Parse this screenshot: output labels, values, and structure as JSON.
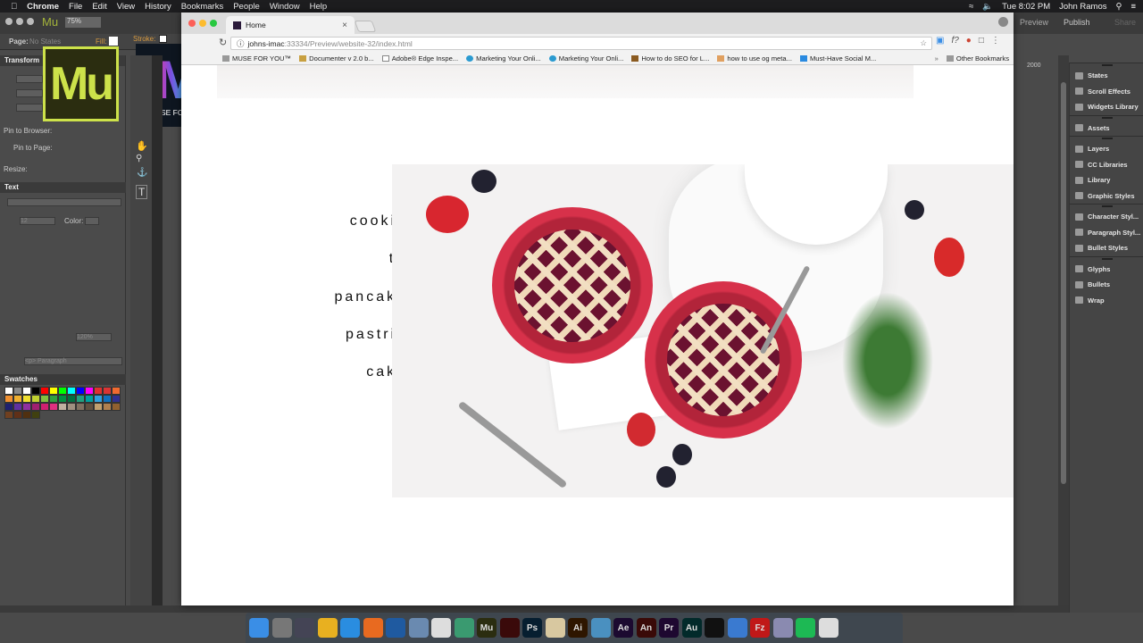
{
  "menubar": {
    "app": "Chrome",
    "items": [
      "File",
      "Edit",
      "View",
      "History",
      "Bookmarks",
      "People",
      "Window",
      "Help"
    ],
    "clock": "Tue 8:02 PM",
    "user": "John Ramos"
  },
  "muse": {
    "zoom": "75%",
    "page_label": "Page:",
    "page_value": "No States",
    "fill": "Fill:",
    "stroke": "Stroke:",
    "preview": "Preview",
    "publish": "Publish",
    "share": "Share",
    "ruler_mark": "2000",
    "transform": "Transform",
    "pin_browser": "Pin to Browser:",
    "pin_page": "Pin to Page:",
    "resize": "Resize:",
    "text": "Text",
    "color": "Color:",
    "font_size": "12",
    "leading": "120%",
    "paragraph": "<p> Paragraph",
    "swatches": "Swatches",
    "swatch_colors": [
      "#ffffff",
      "#888888",
      "#ffffff",
      "#000000",
      "#ff0000",
      "#ffff00",
      "#00ff00",
      "#00ffff",
      "#0000ff",
      "#ff00ff",
      "#e03030",
      "#d93535",
      "#f06a30",
      "#f09030",
      "#f0b030",
      "#f0e030",
      "#c0d030",
      "#80c040",
      "#30a040",
      "#009040",
      "#007040",
      "#20a080",
      "#00a0a0",
      "#30a0e0",
      "#1070c0",
      "#303090",
      "#202070",
      "#6030a0",
      "#9030a0",
      "#a02070",
      "#d02070",
      "#e03080",
      "#c0b0a0",
      "#a09080",
      "#807060",
      "#605040",
      "#c0a070",
      "#b08050",
      "#906030",
      "#704020",
      "#603018",
      "#503010",
      "#404010"
    ]
  },
  "rightpanel": {
    "groups": [
      [
        "States",
        "Scroll Effects",
        "Widgets Library"
      ],
      [
        "Assets"
      ],
      [
        "Layers",
        "CC Libraries",
        "Library",
        "Graphic Styles"
      ],
      [
        "Character Styl...",
        "Paragraph Styl...",
        "Bullet Styles"
      ],
      [
        "Glyphs",
        "Bullets",
        "Wrap"
      ]
    ]
  },
  "logos": {
    "mu": "Mu",
    "mfy_letter": "M",
    "mfy_text": "MUSE FOR YOU"
  },
  "browser": {
    "tab_title": "Home",
    "url_host": "johns-imac",
    "url_rest": ":33334/Preview/website-32/index.html",
    "bookmarks": [
      "MUSE FOR YOU™",
      "Documenter v 2.0 b...",
      "Adobe® Edge Inspe...",
      "Marketing Your Onli...",
      "Marketing Your Onli...",
      "How to do SEO for L...",
      "how to use og meta...",
      "Must-Have Social M..."
    ],
    "other_bookmarks": "Other Bookmarks"
  },
  "page": {
    "menu": [
      "cookies",
      "tea",
      "pancakes",
      "pastries",
      "cakes"
    ]
  },
  "dock": [
    {
      "label": "",
      "c": "#3a8ee6"
    },
    {
      "label": "",
      "c": "#777"
    },
    {
      "label": "",
      "c": "#445"
    },
    {
      "label": "",
      "c": "#e8b020"
    },
    {
      "label": "",
      "c": "#2a8de0"
    },
    {
      "label": "",
      "c": "#e86a20"
    },
    {
      "label": "",
      "c": "#1f5aa0"
    },
    {
      "label": "",
      "c": "#6a8ab0"
    },
    {
      "label": "",
      "c": "#ddd"
    },
    {
      "label": "",
      "c": "#3a9a70"
    },
    {
      "label": "Mu",
      "c": "#2b2d10"
    },
    {
      "label": "",
      "c": "#3a0a0a"
    },
    {
      "label": "Ps",
      "c": "#061e30"
    },
    {
      "label": "",
      "c": "#d8c8a0"
    },
    {
      "label": "Ai",
      "c": "#2e1600"
    },
    {
      "label": "",
      "c": "#4a90c0"
    },
    {
      "label": "Ae",
      "c": "#1c0a30"
    },
    {
      "label": "An",
      "c": "#3a0a08"
    },
    {
      "label": "Pr",
      "c": "#1e0830"
    },
    {
      "label": "Au",
      "c": "#022a2a"
    },
    {
      "label": "",
      "c": "#111"
    },
    {
      "label": "",
      "c": "#3a7ad0"
    },
    {
      "label": "Fz",
      "c": "#c01818"
    },
    {
      "label": "",
      "c": "#8a8ab0"
    },
    {
      "label": "",
      "c": "#1db954"
    },
    {
      "label": "",
      "c": "#ddd"
    }
  ]
}
